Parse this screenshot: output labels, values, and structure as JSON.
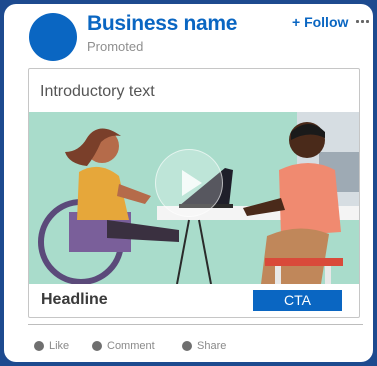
{
  "header": {
    "business_name": "Business name",
    "promoted_label": "Promoted",
    "follow_label": "+ Follow",
    "more_icon": "more-dots-icon"
  },
  "post": {
    "intro_text": "Introductory text",
    "headline": "Headline",
    "cta_label": "CTA",
    "media_icon": "play-icon"
  },
  "actions": [
    {
      "label": "Like",
      "icon": "like-dot-icon"
    },
    {
      "label": "Comment",
      "icon": "comment-dot-icon"
    },
    {
      "label": "Share",
      "icon": "share-dot-icon"
    }
  ],
  "colors": {
    "brand": "#0a66c2",
    "frame": "#1d4a8f",
    "media_bg": "#a9dccb"
  }
}
